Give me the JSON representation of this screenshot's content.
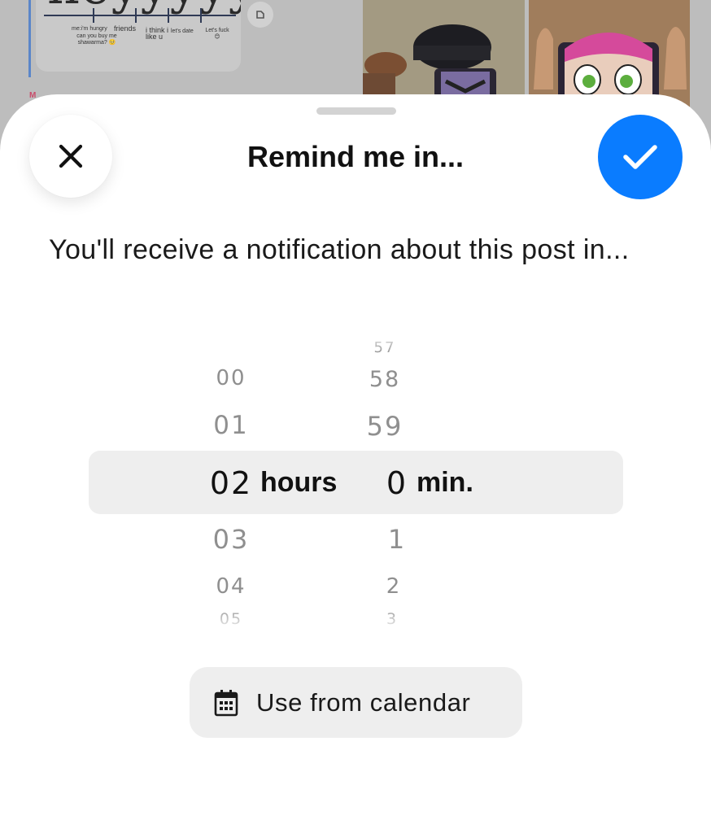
{
  "background": {
    "meme": {
      "title": "heyyyyy",
      "labels": [
        "me:i'm hungry",
        "can you buy me shawarma? 🥺",
        "friends",
        "i think i like u",
        "let's date",
        "Let's fuck 😊"
      ]
    }
  },
  "sheet": {
    "title": "Remind me in...",
    "description": "You'll receive a notification about this post in...",
    "close_icon": "close-icon",
    "confirm_icon": "checkmark-icon",
    "accent_color": "#0a7cff"
  },
  "picker": {
    "hours": {
      "above": [
        "00",
        "01"
      ],
      "selected": "02",
      "below": [
        "03",
        "04",
        "05"
      ],
      "unit": "hours"
    },
    "minutes": {
      "above": [
        "57",
        "58",
        "59"
      ],
      "selected": "0",
      "below": [
        "1",
        "2",
        "3"
      ],
      "unit": "min."
    }
  },
  "calendar_button": {
    "label": "Use from calendar",
    "icon": "calendar-icon"
  }
}
